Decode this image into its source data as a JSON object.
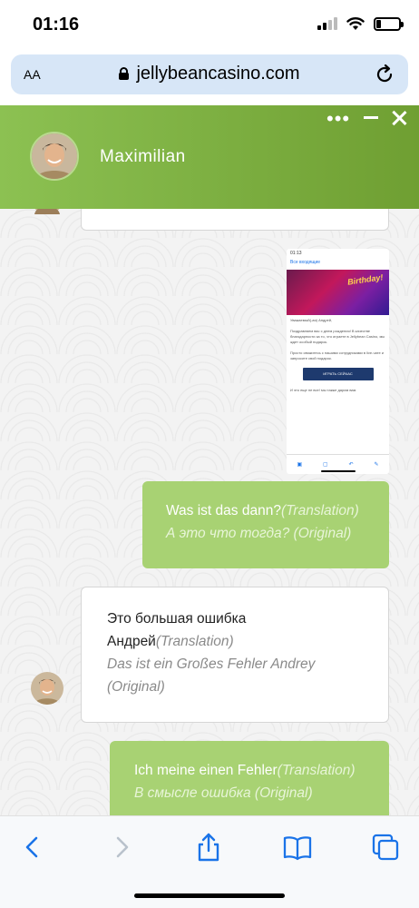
{
  "status_bar": {
    "time": "01:16",
    "signal_bars": 4,
    "signal_active": 2,
    "battery_level": 0.2
  },
  "browser": {
    "text_size_label": "AA",
    "url": "jellybeancasino.com"
  },
  "chat": {
    "agent_name": "Maximilian",
    "messages": [
      {
        "side": "user",
        "main": "Was ist das dann?",
        "main_tag": "(Translation)",
        "original": "А это что тогда? (Original)"
      },
      {
        "side": "agent",
        "main_line1": "Это большая ошибка",
        "main_line2": "Андрей",
        "main_tag": "(Translation)",
        "original_line1": "Das ist ein Großes Fehler Andrey",
        "original_line2": "(Original)"
      },
      {
        "side": "user",
        "main": "Ich meine einen Fehler",
        "main_tag": "(Translation)",
        "original": "В смысле ошибка (Original)"
      }
    ],
    "attachment_screenshot": {
      "time": "01:13",
      "back_label": "Все входящие",
      "banner_title": "Birthday!",
      "body_greeting": "Уважаемый(-ая) Андрей,",
      "body_line1": "Поздравляем вас с днем рождения! В качестве благодарности за то, что играете в Jellybean Casino, мы ждет особый подарок.",
      "body_line2": "Просто свяжитесь с нашими сотрудниками в live-чате и запросите свой подарок.",
      "cta_label": "ИГРАТЬ СЕЙЧАС",
      "footer_line": "И это еще не все! мы также дарим вам"
    }
  },
  "colors": {
    "header_green_start": "#8cc152",
    "header_green_end": "#6f9f32",
    "user_bubble": "#a8d273",
    "agent_bubble": "#ffffff",
    "browser_accent": "#1a73e8"
  }
}
